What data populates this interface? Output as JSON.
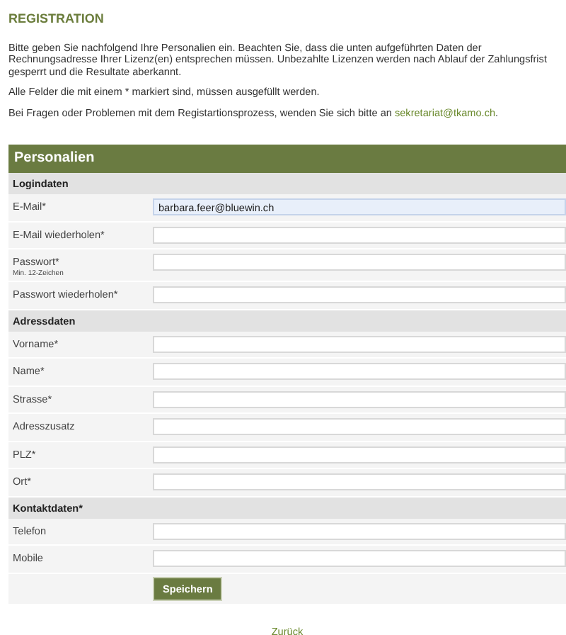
{
  "title": "REGISTRATION",
  "intro": [
    "Bitte geben Sie nachfolgend Ihre Personalien ein. Beachten Sie, dass die unten aufgeführten Daten der Rechnungsadresse Ihrer Lizenz(en) entsprechen müssen. Unbezahlte Lizenzen werden nach Ablauf der Zahlungsfrist gesperrt und die Resultate aberkannt.",
    "Alle Felder die mit einem * markiert sind, müssen ausgefüllt werden."
  ],
  "contact": {
    "text": "Bei Fragen oder Problemen mit dem Registartionsprozess, wenden Sie sich bitte an ",
    "link": "sekretariat@tkamo.ch",
    "suffix": "."
  },
  "panel": {
    "title": "Personalien",
    "sections": [
      {
        "title": "Logindaten",
        "fields": [
          {
            "label": "E-Mail*",
            "value": "barbara.feer@bluewin.ch",
            "focused": true
          },
          {
            "label": "E-Mail wiederholen*",
            "focused": false
          },
          {
            "label": "Passwort*",
            "hint": "Min. 12-Zeichen",
            "focused": false
          },
          {
            "label": "Passwort wiederholen*",
            "focused": false
          }
        ]
      },
      {
        "title": "Adressdaten",
        "fields": [
          {
            "label": "Vorname*",
            "focused": false
          },
          {
            "label": "Name*",
            "focused": false
          },
          {
            "label": "Strasse*",
            "focused": false
          },
          {
            "label": "Adresszusatz",
            "focused": false
          },
          {
            "label": "PLZ*",
            "focused": false
          },
          {
            "label": "Ort*",
            "focused": false
          }
        ]
      },
      {
        "title": "Kontaktdaten*",
        "fields": [
          {
            "label": "Telefon",
            "focused": false
          },
          {
            "label": "Mobile",
            "focused": false
          }
        ]
      }
    ],
    "submit": "Speichern"
  },
  "back": "Zurück"
}
